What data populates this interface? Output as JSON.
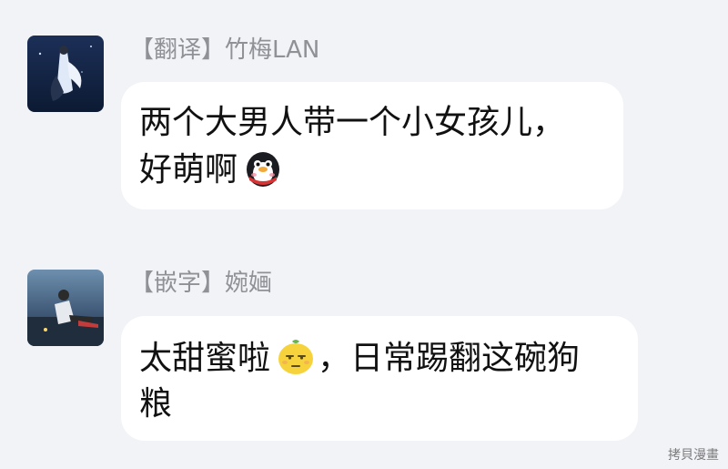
{
  "messages": [
    {
      "sender": "【翻译】竹梅LAN",
      "lines": [
        "两个大男人带一个小女孩儿，",
        "好萌啊"
      ],
      "emoji": "penguin-emoji"
    },
    {
      "sender": "【嵌字】婉婳",
      "lines": [
        "太甜蜜啦",
        "，日常踢翻这碗狗",
        "粮"
      ],
      "emoji": "lemon-emoji"
    }
  ],
  "watermark": "拷貝漫畫",
  "colors": {
    "background": "#f2f3f7",
    "bubble": "#ffffff",
    "sender_text": "#8f9196",
    "message_text": "#111111"
  }
}
